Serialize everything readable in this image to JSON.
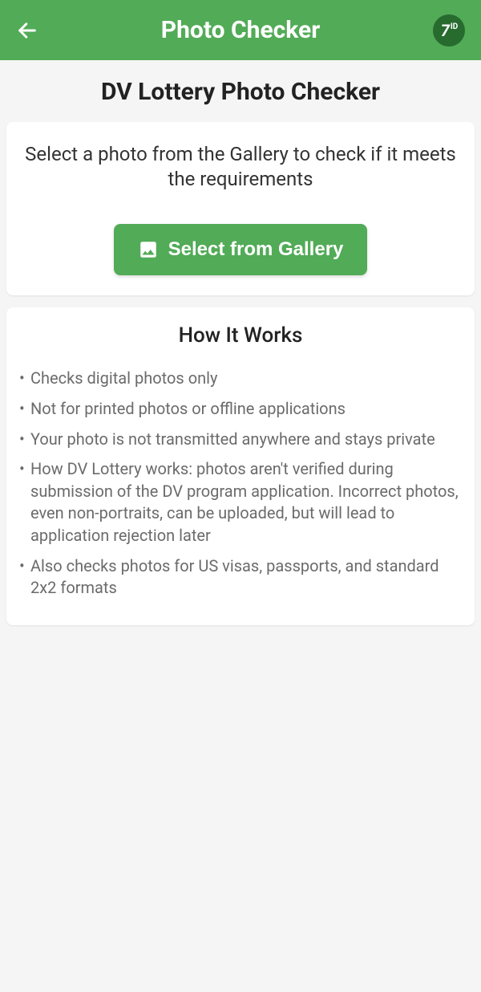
{
  "header": {
    "title": "Photo Checker",
    "logo_main": "7",
    "logo_sub": "ID"
  },
  "page": {
    "title": "DV Lottery Photo Checker"
  },
  "upload_card": {
    "instruction": "Select a photo from the Gallery to check if it meets the requirements",
    "button_label": "Select from Gallery"
  },
  "how_it_works": {
    "title": "How It Works",
    "items": [
      "Checks digital photos only",
      "Not for printed photos or offline applications",
      "Your photo is not transmitted anywhere and stays private",
      "How DV Lottery works: photos aren't verified during submission of the DV program application. Incorrect photos, even non-portraits, can be uploaded, but will lead to application rejection later",
      "Also checks photos for US visas, passports, and standard 2x2 formats"
    ]
  }
}
